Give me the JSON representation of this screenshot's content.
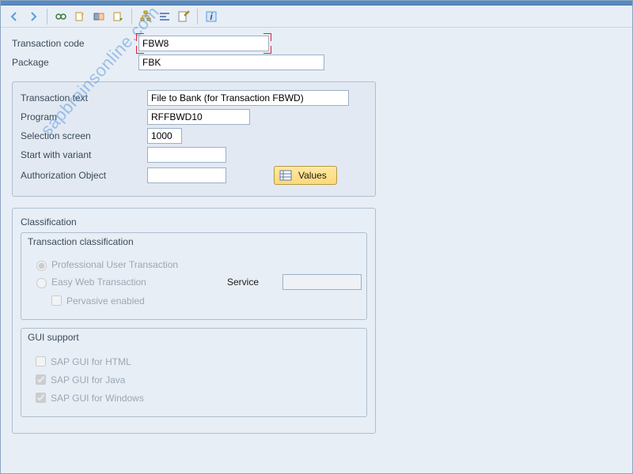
{
  "watermark": "sapbrainsonline.com",
  "toolbar": {
    "icons": [
      "back",
      "forward",
      "glasses",
      "create",
      "modify",
      "another",
      "tree",
      "align",
      "edit",
      "info"
    ]
  },
  "header": {
    "transaction_code_label": "Transaction code",
    "transaction_code_value": "FBW8",
    "package_label": "Package",
    "package_value": "FBK"
  },
  "main": {
    "transaction_text_label": "Transaction text",
    "transaction_text_value": "File to Bank (for Transaction FBWD)",
    "program_label": "Program",
    "program_value": "RFFBWD10",
    "selection_screen_label": "Selection screen",
    "selection_screen_value": "1000",
    "start_variant_label": "Start with variant",
    "start_variant_value": "",
    "auth_object_label": "Authorization Object",
    "auth_object_value": "",
    "values_button": "Values"
  },
  "classification": {
    "title": "Classification",
    "trans_class_legend": "Transaction classification",
    "professional": "Professional User Transaction",
    "easy_web": "Easy Web Transaction",
    "service_label": "Service",
    "service_value": "",
    "pervasive": "Pervasive enabled",
    "gui_legend": "GUI support",
    "gui_html": "SAP GUI for HTML",
    "gui_java": "SAP GUI for Java",
    "gui_windows": "SAP GUI for Windows"
  }
}
